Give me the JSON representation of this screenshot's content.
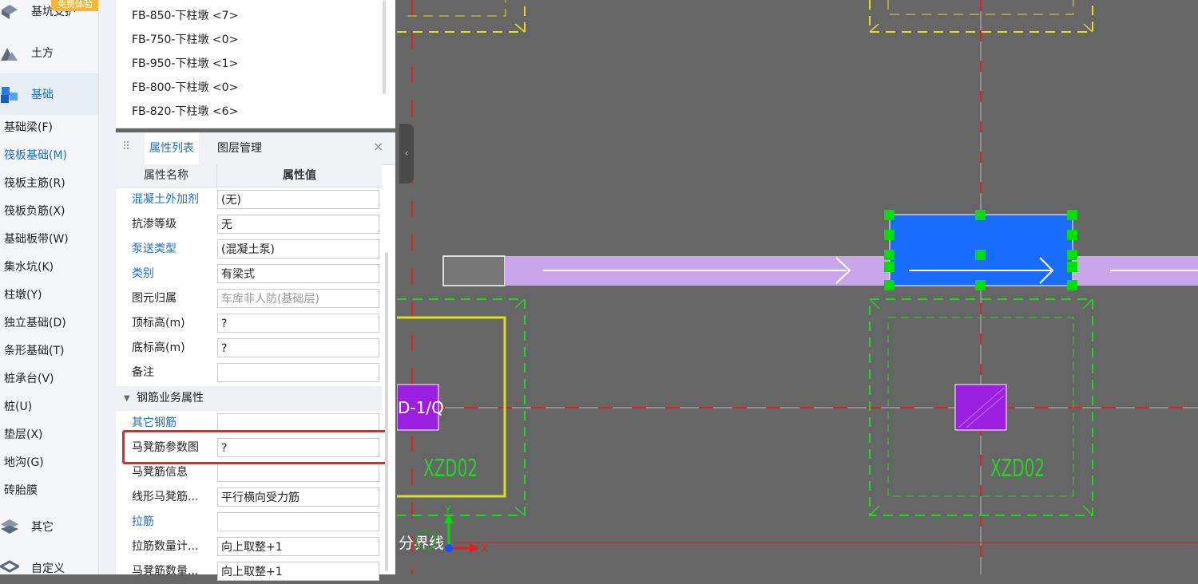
{
  "nav": {
    "badge": "免费体验",
    "categories": [
      {
        "label": "基坑支护",
        "icon": "foundation-pit-icon"
      },
      {
        "label": "土方",
        "icon": "earthwork-icon"
      },
      {
        "label": "基础",
        "icon": "foundation-icon"
      },
      {
        "label": "其它",
        "icon": "other-icon"
      },
      {
        "label": "自定义",
        "icon": "custom-icon"
      }
    ],
    "items": [
      "基础梁(F)",
      "筏板基础(M)",
      "筏板主筋(R)",
      "筏板负筋(X)",
      "基础板带(W)",
      "集水坑(K)",
      "柱墩(Y)",
      "独立基础(D)",
      "条形基础(T)",
      "桩承台(V)",
      "桩(U)",
      "垫层(X)",
      "地沟(G)",
      "砖胎膜"
    ],
    "selected_item": "筏板基础(M)"
  },
  "component_list": [
    "FB-850-下柱墩 <7>",
    "FB-750-下柱墩 <0>",
    "FB-950-下柱墩 <1>",
    "FB-800-下柱墩 <0>",
    "FB-820-下柱墩 <6>"
  ],
  "props": {
    "tabs": [
      "属性列表",
      "图层管理"
    ],
    "active_tab": "属性列表",
    "close_glyph": "×",
    "header": {
      "name": "属性名称",
      "value": "属性值"
    },
    "rows": [
      {
        "name": "混凝土外加剂",
        "value": "(无)",
        "link": true
      },
      {
        "name": "抗渗等级",
        "value": "无",
        "link": false
      },
      {
        "name": "泵送类型",
        "value": "(混凝土泵)",
        "link": true
      },
      {
        "name": "类别",
        "value": "有梁式",
        "link": true
      },
      {
        "name": "图元归属",
        "value": "车库非人防(基础层)",
        "link": false
      },
      {
        "name": "顶标高(m)",
        "value": "?",
        "link": false
      },
      {
        "name": "底标高(m)",
        "value": "?",
        "link": false
      },
      {
        "name": "备注",
        "value": "",
        "link": false
      }
    ],
    "group": "钢筋业务属性",
    "group_rows": [
      {
        "name": "其它钢筋",
        "value": "",
        "link": true
      },
      {
        "name": "马凳筋参数图",
        "value": "?",
        "link": false
      },
      {
        "name": "马凳筋信息",
        "value": "",
        "link": false
      },
      {
        "name": "线形马凳筋...",
        "value": "平行横向受力筋",
        "link": false
      },
      {
        "name": "拉筋",
        "value": "",
        "link": true
      },
      {
        "name": "拉筋数量计...",
        "value": "向上取整+1",
        "link": false
      },
      {
        "name": "马凳筋数量...",
        "value": "向上取整+1",
        "link": false
      }
    ]
  },
  "canvas": {
    "labels": {
      "left_column": "D-1/Q",
      "left_tag": "XZD02",
      "right_tag": "XZD02",
      "boundary": "分界线",
      "axis_x": "X",
      "axis_y": "Y"
    },
    "colors": {
      "background": "#666666",
      "selected_fill": "#1a6cff",
      "beam_fill": "#c9a6ea",
      "pier_fill": "#9b1fe0",
      "dash_green": "#25d425",
      "dash_yellow": "#e0e020",
      "axis_red": "#e02020",
      "handle": "#00e000"
    }
  }
}
